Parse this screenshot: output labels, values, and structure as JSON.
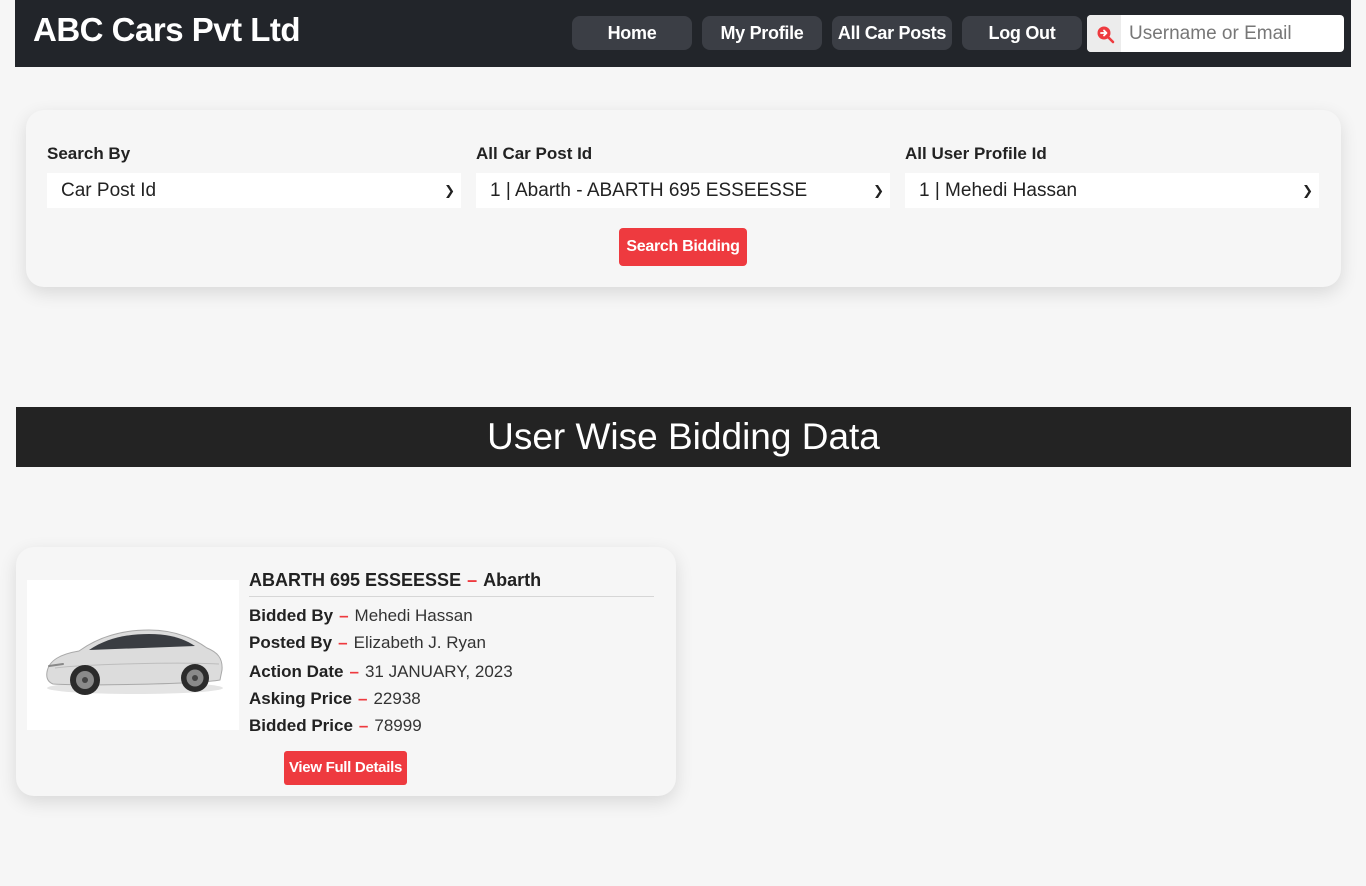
{
  "header": {
    "brand": "ABC Cars Pvt Ltd",
    "nav": {
      "home": "Home",
      "my_profile": "My Profile",
      "all_car_posts": "All Car Posts",
      "log_out": "Log Out"
    },
    "search": {
      "placeholder": "Username or Email",
      "value": "",
      "icon": "search-arrow-icon"
    }
  },
  "filters": {
    "search_by": {
      "label": "Search By",
      "selected": "Car Post Id"
    },
    "car_post": {
      "label": "All Car Post Id",
      "selected": "1 | Abarth - ABARTH 695 ESSEESSE"
    },
    "user_profile": {
      "label": "All User Profile Id",
      "selected": "1 | Mehedi Hassan"
    },
    "submit_label": "Search Bidding"
  },
  "section_title": "User Wise Bidding Data",
  "bids": [
    {
      "model": "ABARTH 695 ESSEESSE",
      "make": "Abarth",
      "bidded_by_label": "Bidded By",
      "bidded_by": "Mehedi Hassan",
      "posted_by_label": "Posted By",
      "posted_by": "Elizabeth J. Ryan",
      "action_date_label": "Action Date",
      "action_date": "31 JANUARY, 2023",
      "asking_price_label": "Asking Price",
      "asking_price": "22938",
      "bidded_price_label": "Bidded Price",
      "bidded_price": "78999",
      "button_label": "View Full Details"
    }
  ],
  "colors": {
    "nav_bg": "#22252a",
    "accent": "#ee3a3f",
    "band_bg": "#232323",
    "page_bg": "#f6f6f6"
  }
}
